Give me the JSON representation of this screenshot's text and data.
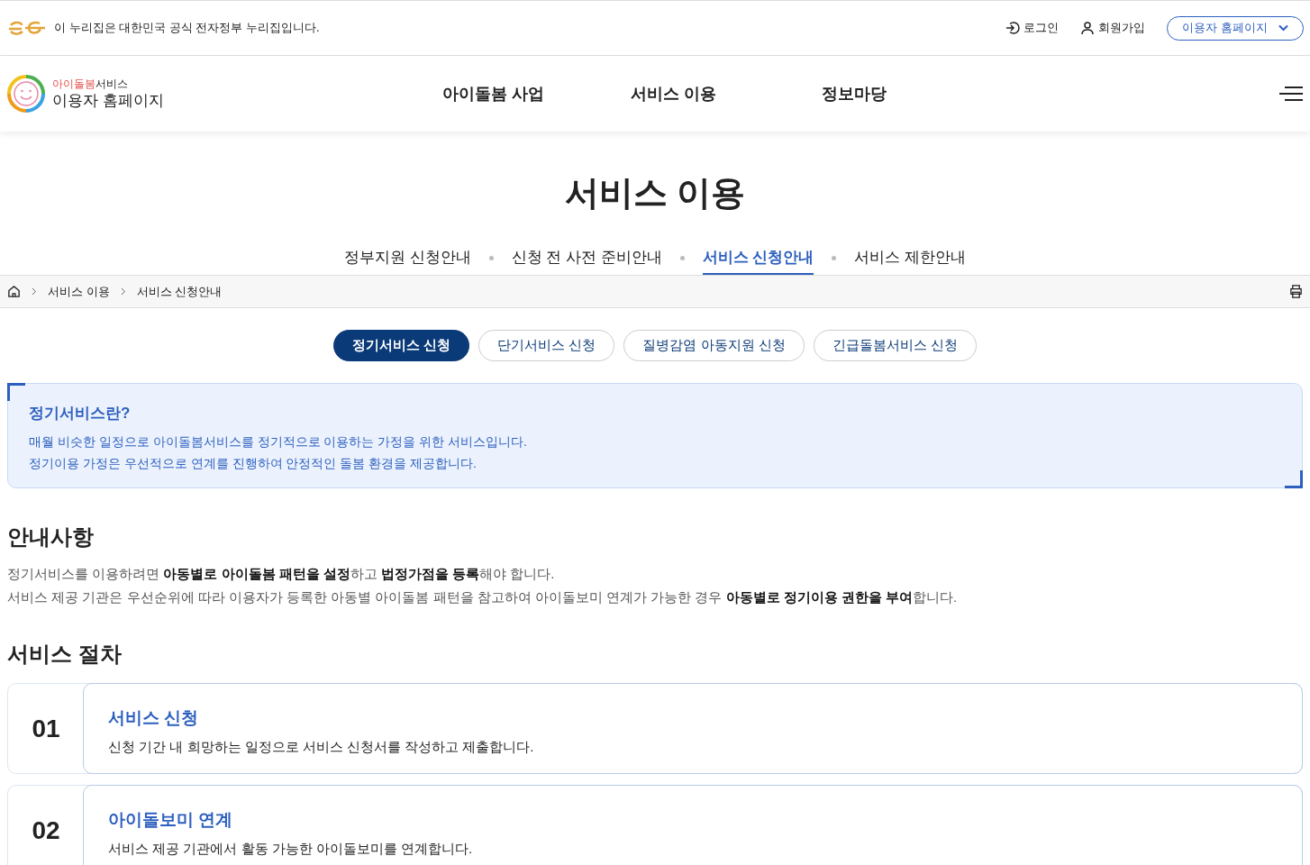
{
  "gov_banner": {
    "text": "이 누리집은 대한민국 공식 전자정부 누리집입니다."
  },
  "top_links": [
    {
      "kind": "login",
      "label": "로그인"
    },
    {
      "kind": "signup",
      "label": "회원가입"
    }
  ],
  "site_select": {
    "label": "이용자 홈페이지"
  },
  "logo": {
    "brand": "아이돌봄",
    "brand_suffix": "서비스",
    "subtitle": "이용자 홈페이지"
  },
  "main_nav": [
    {
      "label": "아이돌봄 사업"
    },
    {
      "label": "서비스 이용"
    },
    {
      "label": "정보마당"
    }
  ],
  "page_title": "서비스 이용",
  "sub_tabs": [
    {
      "label": "정부지원 신청안내",
      "selected": false
    },
    {
      "label": "신청 전 사전 준비안내",
      "selected": false
    },
    {
      "label": "서비스 신청안내",
      "selected": true
    },
    {
      "label": "서비스 제한안내",
      "selected": false
    }
  ],
  "breadcrumb": [
    "서비스 이용",
    "서비스 신청안내"
  ],
  "pill_tabs": [
    {
      "label": "정기서비스 신청",
      "selected": true
    },
    {
      "label": "단기서비스 신청",
      "selected": false
    },
    {
      "label": "질병감염 아동지원 신청",
      "selected": false
    },
    {
      "label": "긴급돌봄서비스 신청",
      "selected": false
    }
  ],
  "info_box": {
    "title": "정기서비스란?",
    "lines": [
      "매월 비슷한 일정으로 아이돌봄서비스를 정기적으로 이용하는 가정을 위한 서비스입니다.",
      "정기이용 가정은 우선적으로 연계를 진행하여 안정적인 돌봄 환경을 제공합니다."
    ]
  },
  "notice": {
    "heading": "안내사항",
    "lines": [
      "정기서비스를 이용하려면 **아동별로 아이돌봄 패턴을 설정**하고 **법정가점을 등록**해야 합니다.",
      "서비스 제공 기관은 우선순위에 따라 이용자가 등록한 아동별 아이돌봄 패턴을 참고하여 아이돌보미 연계가 가능한 경우 **아동별로 정기이용 권한을 부여**합니다."
    ]
  },
  "procedure": {
    "heading": "서비스 절차",
    "steps": [
      {
        "number": "01",
        "title": "서비스 신청",
        "description": "신청 기간 내 희망하는 일정으로 서비스 신청서를 작성하고 제출합니다."
      },
      {
        "number": "02",
        "title": "아이돌보미 연계",
        "description": "서비스 제공 기관에서 활동 가능한 아이돌보미를 연계합니다."
      }
    ]
  }
}
